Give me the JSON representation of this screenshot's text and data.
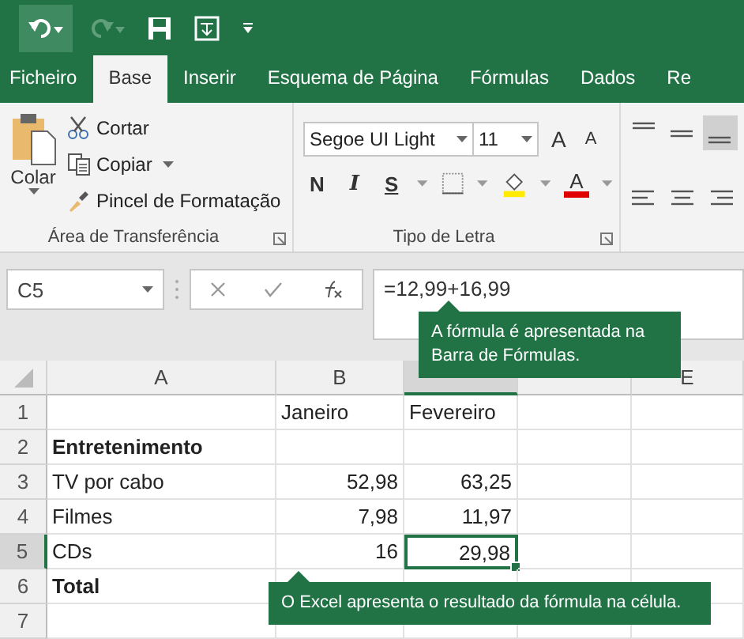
{
  "tabs": [
    {
      "label": "Ficheiro",
      "selected": false
    },
    {
      "label": "Base",
      "selected": true
    },
    {
      "label": "Inserir",
      "selected": false
    },
    {
      "label": "Esquema de Página",
      "selected": false
    },
    {
      "label": "Fórmulas",
      "selected": false
    },
    {
      "label": "Dados",
      "selected": false
    },
    {
      "label": "Re",
      "selected": false
    }
  ],
  "clipboard": {
    "paste": "Colar",
    "commands": [
      {
        "kind": "cut",
        "label": "Cortar"
      },
      {
        "kind": "copy",
        "label": "Copiar"
      },
      {
        "kind": "brush",
        "label": "Pincel de Formatação"
      }
    ],
    "group_label": "Área de Transferência"
  },
  "font": {
    "font_name": "Segoe UI Light",
    "font_size": "11",
    "grow": "A",
    "shrink": "A",
    "bold": "N",
    "italic": "I",
    "underline": "S",
    "font_color": "A",
    "group_label": "Tipo de Letra"
  },
  "alignment": [
    {
      "kind": "top",
      "selected": false
    },
    {
      "kind": "middle",
      "selected": false
    },
    {
      "kind": "bottom",
      "selected": true
    },
    {
      "kind": "left",
      "selected": false
    },
    {
      "kind": "center",
      "selected": false
    },
    {
      "kind": "right",
      "selected": false
    }
  ],
  "formula_bar": {
    "name_box": "C5",
    "formula": "=12,99+16,99"
  },
  "callouts": [
    {
      "text": "A fórmula é apresentada na Barra de Fórmulas."
    },
    {
      "text": "O Excel apresenta o resultado da fórmula na célula."
    }
  ],
  "columns": [
    {
      "label": "A",
      "selected": false
    },
    {
      "label": "B",
      "selected": false
    },
    {
      "selected": true
    },
    {
      "selected": false
    },
    {
      "label": "E",
      "selected": false
    }
  ],
  "rows": [
    {
      "label": "1",
      "selected": false,
      "cells": [
        null,
        {
          "text": "Janeiro",
          "kind": "text"
        },
        {
          "text": "Fevereiro",
          "kind": "text"
        }
      ]
    },
    {
      "label": "2",
      "selected": false,
      "cells": [
        {
          "text": "Entretenimento",
          "kind": "text",
          "bold": true
        }
      ]
    },
    {
      "label": "3",
      "selected": false,
      "cells": [
        {
          "text": "TV por cabo",
          "kind": "text"
        },
        {
          "text": "52,98",
          "kind": "number"
        },
        {
          "text": "63,25",
          "kind": "number"
        }
      ]
    },
    {
      "label": "4",
      "selected": false,
      "cells": [
        {
          "text": "Filmes",
          "kind": "text"
        },
        {
          "text": "7,98",
          "kind": "number"
        },
        {
          "text": "11,97",
          "kind": "number"
        }
      ]
    },
    {
      "label": "5",
      "selected": true,
      "cells": [
        {
          "text": "CDs",
          "kind": "text"
        },
        {
          "text": "16",
          "kind": "number"
        },
        {
          "text": "29,98",
          "kind": "number",
          "active": true
        }
      ]
    },
    {
      "label": "6",
      "selected": false,
      "cells": [
        {
          "text": "Total",
          "kind": "text",
          "bold": true
        }
      ]
    },
    {
      "label": "7",
      "selected": false,
      "cells": []
    }
  ]
}
